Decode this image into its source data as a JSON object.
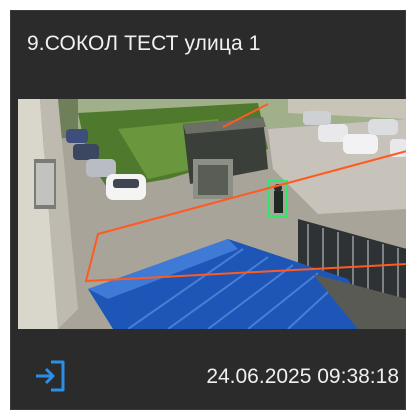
{
  "camera_card": {
    "title": "9.СОКОЛ ТЕСТ улица 1",
    "timestamp": "24.06.2025 09:38:18",
    "footer_icon": "sign-in-icon",
    "zone_color": "#ff5a1f",
    "detection_color": "#2ee86a",
    "icon_color": "#2a8fe8",
    "background_color": "#2b2b2b"
  }
}
